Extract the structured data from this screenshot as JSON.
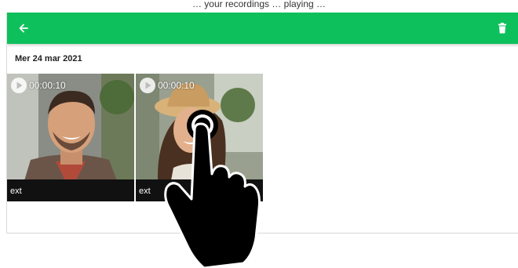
{
  "page_caption": "… your recordings … playing …",
  "appbar": {
    "color": "#0ec05c",
    "back_icon": "arrow-left-icon",
    "delete_icon": "trash-icon"
  },
  "gallery": {
    "date_header": "Mer 24 mar 2021",
    "items": [
      {
        "duration": "00:00:10",
        "label": "ext",
        "subject": "smiling man portrait"
      },
      {
        "duration": "00:00:10",
        "label": "ext",
        "subject": "woman with hat portrait"
      }
    ]
  },
  "gesture": {
    "icon": "tap-hand-icon"
  }
}
